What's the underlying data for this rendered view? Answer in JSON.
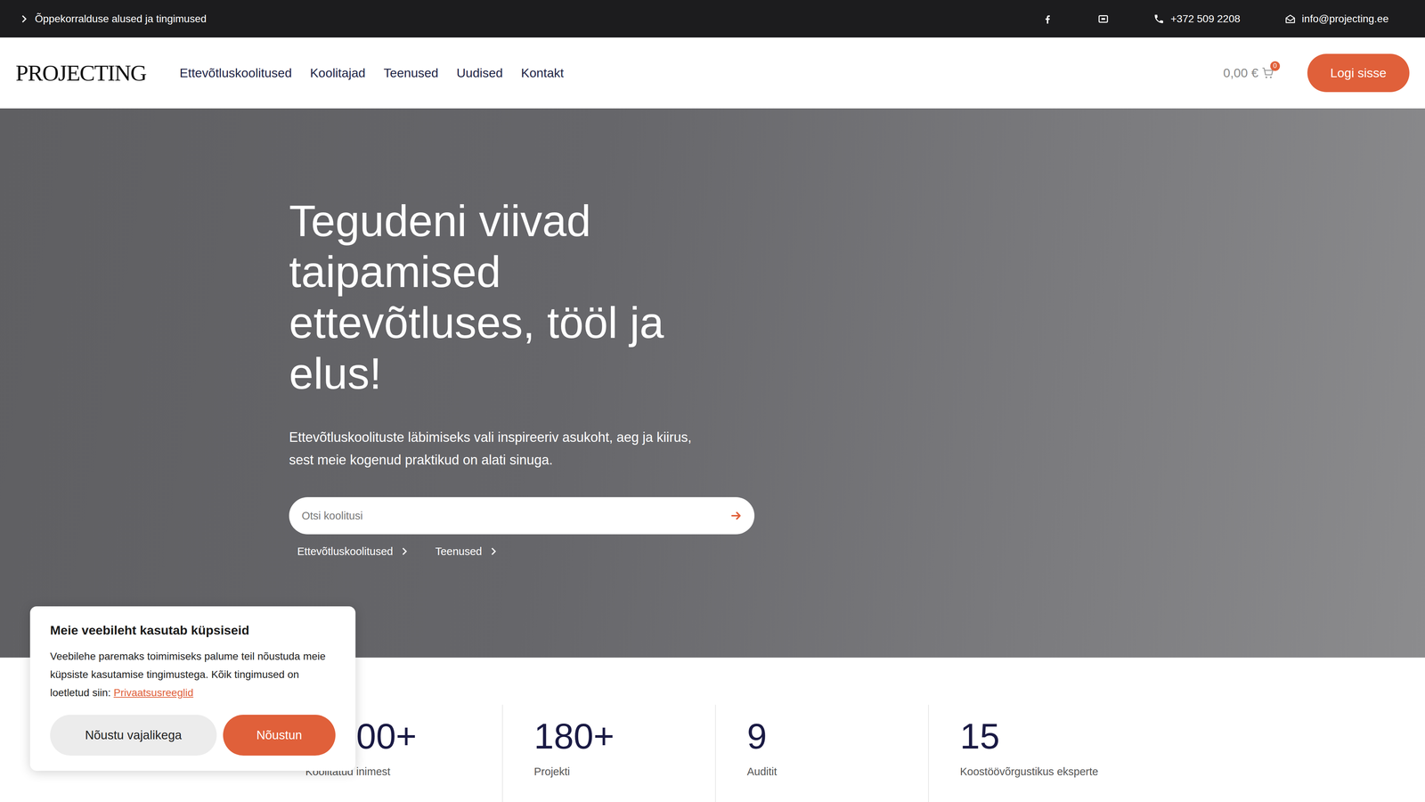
{
  "topbar": {
    "link": "Õppekorralduse alused ja tingimused",
    "phone": "+372 509 2208",
    "email": "info@projecting.ee"
  },
  "logo": "PROJECTING",
  "nav": {
    "items": [
      "Ettevõtluskoolitused",
      "Koolitajad",
      "Teenused",
      "Uudised",
      "Kontakt"
    ],
    "cart": {
      "total": "0,00 €",
      "count": "0"
    },
    "login": "Logi sisse"
  },
  "hero": {
    "heading": [
      "Tegudeni viivad",
      "taipamised",
      "ettevõtluses, tööl ja",
      "elus!"
    ],
    "subtitle": [
      "Ettevõtluskoolituste läbimiseks vali inspireeriv asukoht, aeg ja kiirus,",
      "sest meie kogenud praktikud on alati sinuga."
    ],
    "search": {
      "placeholder": "Otsi koolitusi"
    },
    "links": [
      "Ettevõtluskoolitused",
      "Teenused"
    ]
  },
  "stats": [
    {
      "value": "00+",
      "label": "Koolitatud inimest"
    },
    {
      "value": "180+",
      "label": "Projekti"
    },
    {
      "value": "9",
      "label": "Auditit"
    },
    {
      "value": "15",
      "label": "Koostöövõrgustikus eksperte"
    }
  ],
  "cookie": {
    "title": "Meie veebileht kasutab küpsiseid",
    "text": "Veebilehe paremaks toimimiseks palume teil nõustuda meie küpsiste kasutamise tingimustega. Kõik tingimused on loetletud siin:",
    "link": "Privaatsusreeglid",
    "buttons": [
      "Nõustu vajalikega",
      "Nõustun"
    ]
  }
}
